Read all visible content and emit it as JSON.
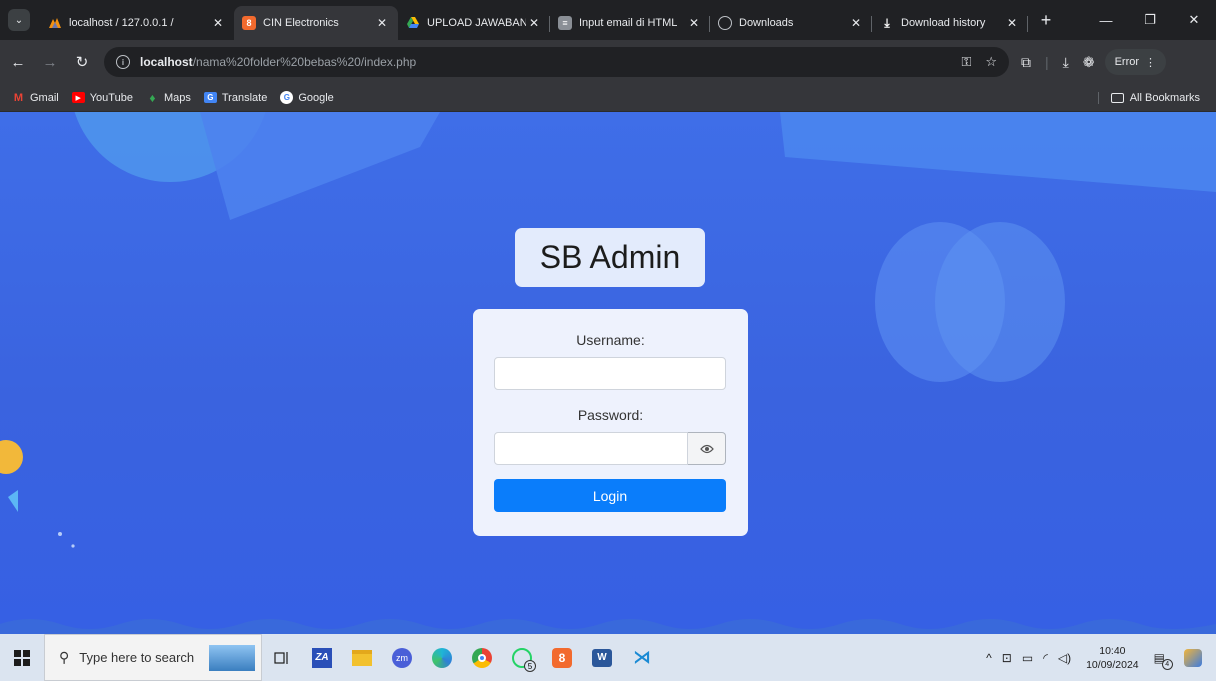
{
  "browser": {
    "tabs": [
      {
        "label": "localhost / 127.0.0.1 /",
        "favicon": "phpmyadmin-icon",
        "active": false,
        "closable": true
      },
      {
        "label": "CIN Electronics",
        "favicon": "cin-icon",
        "active": true,
        "closable": true
      },
      {
        "label": "UPLOAD JAWABAN U",
        "favicon": "google-drive-icon",
        "active": false,
        "closable": true
      },
      {
        "label": "Input email di HTML",
        "favicon": "stackoverflow-icon",
        "active": false,
        "closable": true
      },
      {
        "label": "Downloads",
        "favicon": "chrome-settings-icon",
        "active": false,
        "closable": true
      },
      {
        "label": "Download history",
        "favicon": "download-icon",
        "active": false,
        "closable": true
      }
    ],
    "new_tab_symbol": "+",
    "window_controls": [
      "—",
      "❐",
      "✕"
    ],
    "url": {
      "host": "localhost",
      "path": "/nama%20folder%20bebas%20/index.php"
    },
    "error_button": "Error",
    "bookmarks": [
      {
        "label": "Gmail",
        "icon": "gmail-icon"
      },
      {
        "label": "YouTube",
        "icon": "youtube-icon"
      },
      {
        "label": "Maps",
        "icon": "maps-icon"
      },
      {
        "label": "Translate",
        "icon": "translate-icon"
      },
      {
        "label": "Google",
        "icon": "google-icon"
      }
    ],
    "all_bookmarks": "All Bookmarks"
  },
  "page": {
    "brand": "SB Admin",
    "username_label": "Username:",
    "username_value": "",
    "password_label": "Password:",
    "password_value": "",
    "login_button": "Login",
    "colors": {
      "background": "#3f6ee8",
      "card": "#eef2fd",
      "brand_box": "#e3ebfc",
      "login": "#0a7dfb"
    }
  },
  "taskbar": {
    "search_placeholder": "Type here to search",
    "apps": [
      "task-view-icon",
      "app-zm-icon",
      "file-explorer-icon",
      "zoom-icon",
      "edge-icon",
      "chrome-icon",
      "whatsapp-icon",
      "cin-icon",
      "word-icon",
      "vscode-icon"
    ],
    "whatsapp_badge": "5",
    "time": "10:40",
    "date": "10/09/2024",
    "notifications": "4"
  }
}
